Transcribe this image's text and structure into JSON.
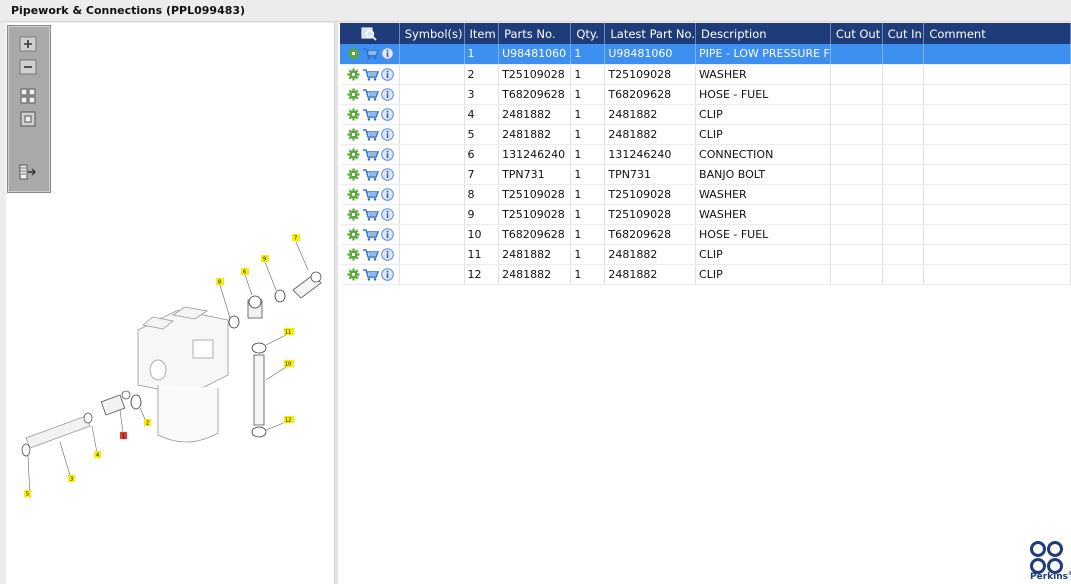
{
  "window": {
    "title": "Pipework & Connections (PPL099483)"
  },
  "toolbar": {
    "buttons": [
      {
        "name": "zoom-in-button",
        "icon": "zoom-in-icon"
      },
      {
        "name": "zoom-out-button",
        "icon": "zoom-out-icon"
      },
      {
        "name": "fit-all-button",
        "icon": "fit-all-icon"
      },
      {
        "name": "fit-window-button",
        "icon": "fit-window-icon"
      },
      {
        "name": "export-button",
        "icon": "export-icon"
      }
    ]
  },
  "drawing": {
    "callouts": [
      {
        "label": "7",
        "highlight": "yellow"
      },
      {
        "label": "8",
        "highlight": "yellow"
      },
      {
        "label": "6",
        "highlight": "yellow"
      },
      {
        "label": "9",
        "highlight": "yellow"
      },
      {
        "label": "11",
        "highlight": "yellow"
      },
      {
        "label": "10",
        "highlight": "yellow"
      },
      {
        "label": "12",
        "highlight": "yellow"
      },
      {
        "label": "1",
        "highlight": "red"
      },
      {
        "label": "2",
        "highlight": "yellow"
      },
      {
        "label": "4",
        "highlight": "yellow"
      },
      {
        "label": "3",
        "highlight": "yellow"
      },
      {
        "label": "5",
        "highlight": "yellow"
      }
    ]
  },
  "table": {
    "columns": [
      "",
      "Symbol(s)",
      "Item",
      "Parts No.",
      "Qty.",
      "Latest Part No.",
      "Description",
      "Cut Out",
      "Cut In",
      "Comment"
    ],
    "rows": [
      {
        "item": "1",
        "parts_no": "U98481060",
        "qty": "1",
        "latest": "U98481060",
        "description": "PIPE - LOW PRESSURE F",
        "selected": true
      },
      {
        "item": "2",
        "parts_no": "T25109028",
        "qty": "1",
        "latest": "T25109028",
        "description": "WASHER"
      },
      {
        "item": "3",
        "parts_no": "T68209628",
        "qty": "1",
        "latest": "T68209628",
        "description": "HOSE - FUEL"
      },
      {
        "item": "4",
        "parts_no": "2481882",
        "qty": "1",
        "latest": "2481882",
        "description": "CLIP"
      },
      {
        "item": "5",
        "parts_no": "2481882",
        "qty": "1",
        "latest": "2481882",
        "description": "CLIP"
      },
      {
        "item": "6",
        "parts_no": "131246240",
        "qty": "1",
        "latest": "131246240",
        "description": "CONNECTION"
      },
      {
        "item": "7",
        "parts_no": "TPN731",
        "qty": "1",
        "latest": "TPN731",
        "description": "BANJO BOLT"
      },
      {
        "item": "8",
        "parts_no": "T25109028",
        "qty": "1",
        "latest": "T25109028",
        "description": "WASHER"
      },
      {
        "item": "9",
        "parts_no": "T25109028",
        "qty": "1",
        "latest": "T25109028",
        "description": "WASHER"
      },
      {
        "item": "10",
        "parts_no": "T68209628",
        "qty": "1",
        "latest": "T68209628",
        "description": "HOSE - FUEL"
      },
      {
        "item": "11",
        "parts_no": "2481882",
        "qty": "1",
        "latest": "2481882",
        "description": "CLIP"
      },
      {
        "item": "12",
        "parts_no": "2481882",
        "qty": "1",
        "latest": "2481882",
        "description": "CLIP"
      }
    ],
    "row_icons": [
      "gear-icon",
      "cart-icon",
      "info-icon"
    ]
  },
  "logo": {
    "text": "Perkins",
    "mark": "®"
  },
  "colors": {
    "header_bg": "#1f3c7a",
    "selected_row": "#3d8ff0",
    "callout_yellow": "#f6f000",
    "callout_red": "#e23a3a",
    "gear": "#5aa83a"
  }
}
